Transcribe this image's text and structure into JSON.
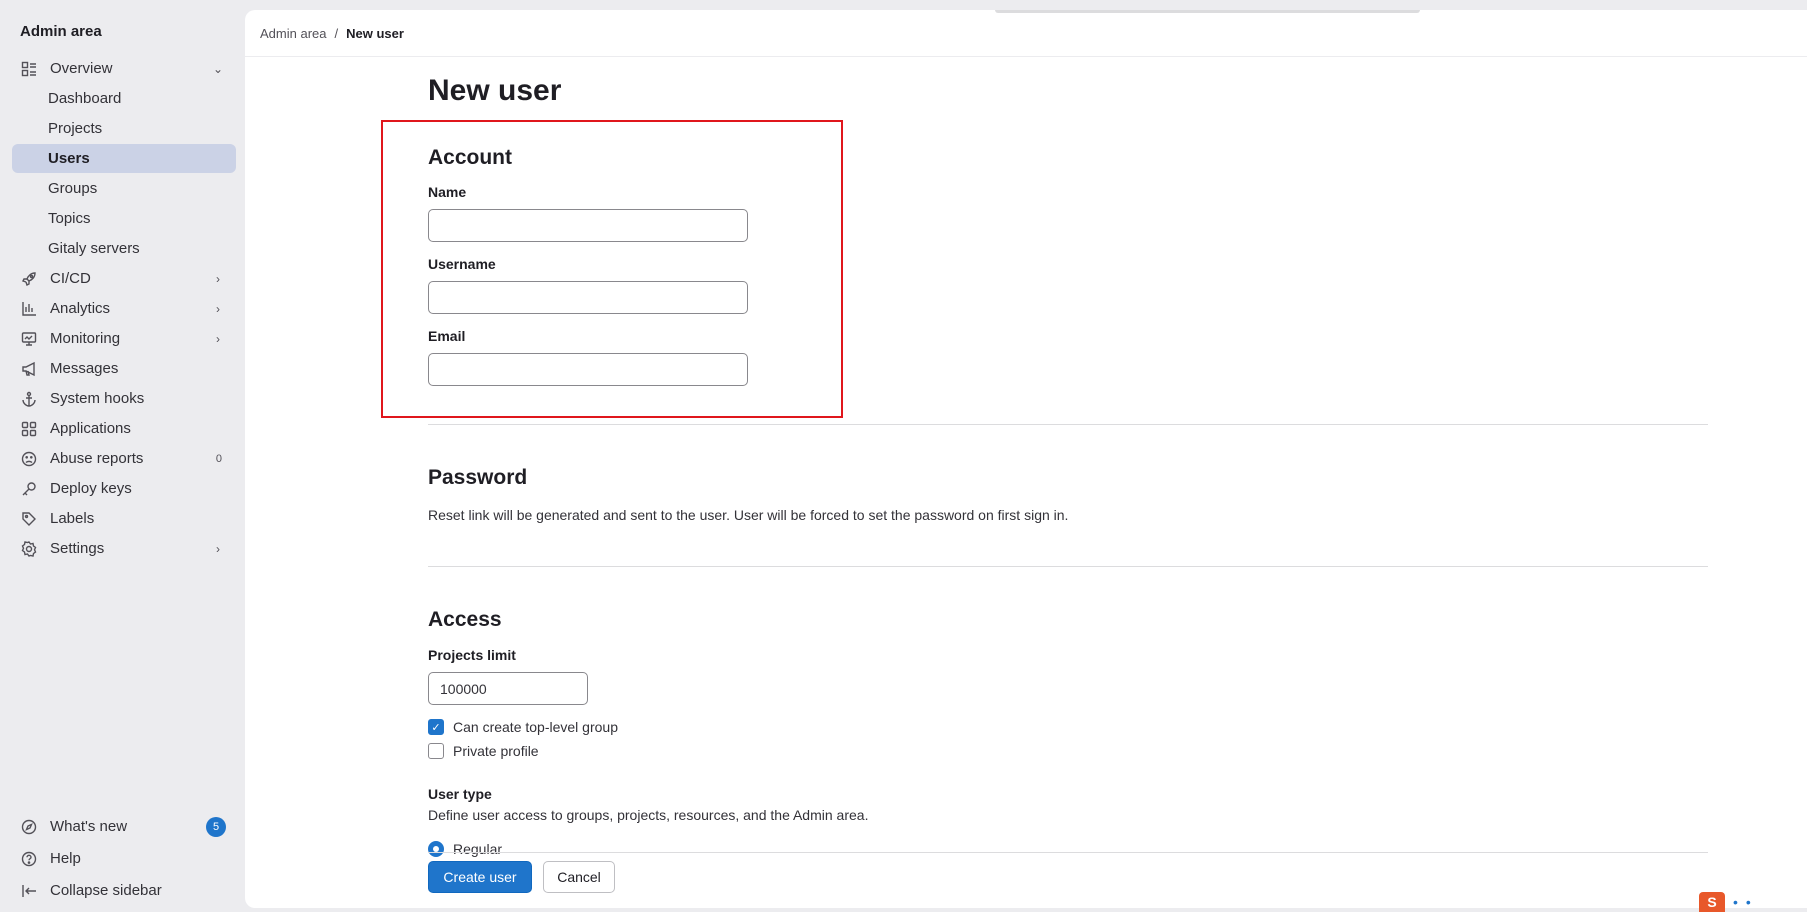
{
  "sidebar": {
    "title": "Admin area",
    "items": [
      {
        "label": "Overview",
        "icon": "overview-icon",
        "chevron": "down"
      },
      {
        "label": "Dashboard",
        "sub": true
      },
      {
        "label": "Projects",
        "sub": true
      },
      {
        "label": "Users",
        "sub": true,
        "active": true
      },
      {
        "label": "Groups",
        "sub": true
      },
      {
        "label": "Topics",
        "sub": true
      },
      {
        "label": "Gitaly servers",
        "sub": true
      },
      {
        "label": "CI/CD",
        "icon": "rocket-icon",
        "chevron": "right"
      },
      {
        "label": "Analytics",
        "icon": "chart-icon",
        "chevron": "right"
      },
      {
        "label": "Monitoring",
        "icon": "monitor-icon",
        "chevron": "right"
      },
      {
        "label": "Messages",
        "icon": "megaphone-icon"
      },
      {
        "label": "System hooks",
        "icon": "anchor-icon"
      },
      {
        "label": "Applications",
        "icon": "grid-icon"
      },
      {
        "label": "Abuse reports",
        "icon": "frown-icon",
        "count": "0"
      },
      {
        "label": "Deploy keys",
        "icon": "key-icon"
      },
      {
        "label": "Labels",
        "icon": "label-icon"
      },
      {
        "label": "Settings",
        "icon": "gear-icon",
        "chevron": "right"
      }
    ],
    "footer": {
      "whats_new": "What's new",
      "whats_new_count": "5",
      "help": "Help",
      "collapse": "Collapse sidebar"
    }
  },
  "breadcrumb": {
    "root": "Admin area",
    "separator": "/",
    "current": "New user"
  },
  "page": {
    "title": "New user",
    "account": {
      "heading": "Account",
      "name_label": "Name",
      "name_value": "",
      "username_label": "Username",
      "username_value": "",
      "email_label": "Email",
      "email_value": ""
    },
    "password": {
      "heading": "Password",
      "description": "Reset link will be generated and sent to the user. User will be forced to set the password on first sign in."
    },
    "access": {
      "heading": "Access",
      "projects_limit_label": "Projects limit",
      "projects_limit_value": "100000",
      "can_create_group_label": "Can create top-level group",
      "can_create_group_checked": true,
      "private_profile_label": "Private profile",
      "private_profile_checked": false,
      "user_type_label": "User type",
      "user_type_description": "Define user access to groups, projects, resources, and the Admin area.",
      "user_type_selected": "Regular"
    },
    "actions": {
      "create": "Create user",
      "cancel": "Cancel"
    }
  },
  "colors": {
    "accent": "#1f75cb",
    "highlight_box": "#e0161c",
    "active_nav": "#cbd2e6"
  }
}
